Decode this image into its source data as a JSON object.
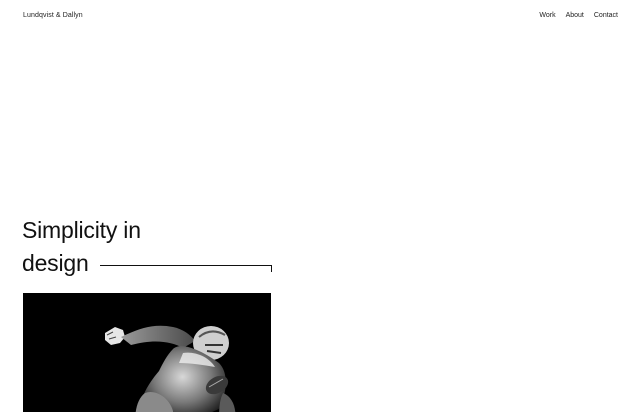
{
  "header": {
    "brand": "Lundqvist & Dallyn",
    "nav": [
      {
        "label": "Work"
      },
      {
        "label": "About"
      },
      {
        "label": "Contact"
      }
    ]
  },
  "hero": {
    "line1": "Simplicity in",
    "line2": "design"
  },
  "feature_image": {
    "subject": "football-player-photo"
  }
}
